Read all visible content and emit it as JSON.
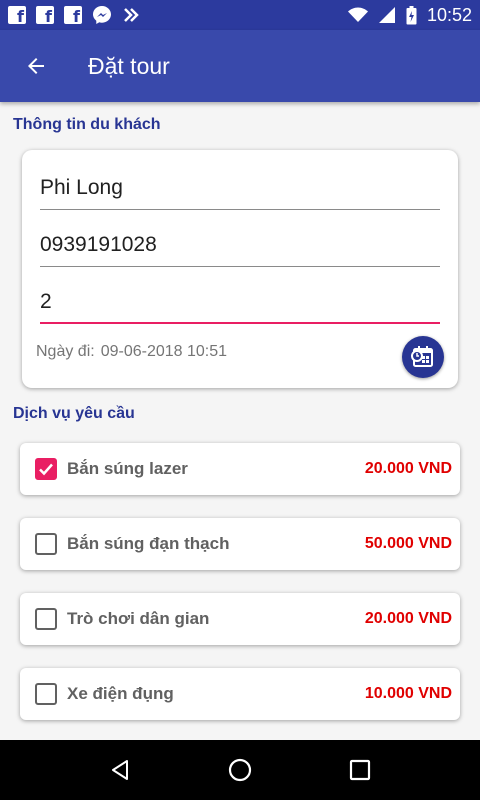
{
  "status_bar": {
    "time": "10:52",
    "left_icons": [
      "facebook-icon",
      "facebook-icon",
      "facebook-icon",
      "messenger-icon",
      "zalo-icon"
    ],
    "right_icons": [
      "wifi-icon",
      "signal-icon",
      "battery-icon"
    ]
  },
  "app_bar": {
    "title": "Đặt tour",
    "back_icon": "arrow-back-icon"
  },
  "visitor_section": {
    "label": "Thông tin du khách",
    "name_value": "Phi Long",
    "phone_value": "0939191028",
    "count_value": "2",
    "date_label": "Ngày đi:",
    "date_value": "09-06-2018 10:51",
    "calendar_icon": "calendar-clock-icon"
  },
  "services_section": {
    "label": "Dịch vụ yêu cầu",
    "items": [
      {
        "name": "Bắn súng lazer",
        "price": "20.000 VND",
        "checked": true
      },
      {
        "name": "Bắn súng đạn thạch",
        "price": "50.000 VND",
        "checked": false
      },
      {
        "name": "Trò chơi dân gian",
        "price": "20.000 VND",
        "checked": false
      },
      {
        "name": "Xe điện đụng",
        "price": "10.000 VND",
        "checked": false
      }
    ]
  },
  "nav_bar": {
    "icons": [
      "back-triangle-icon",
      "home-circle-icon",
      "recents-square-icon"
    ]
  },
  "colors": {
    "primary": "#3949ab",
    "primary_dark": "#2c3a9e",
    "accent": "#e91e63",
    "price": "#e00000",
    "section_label": "#283593"
  }
}
